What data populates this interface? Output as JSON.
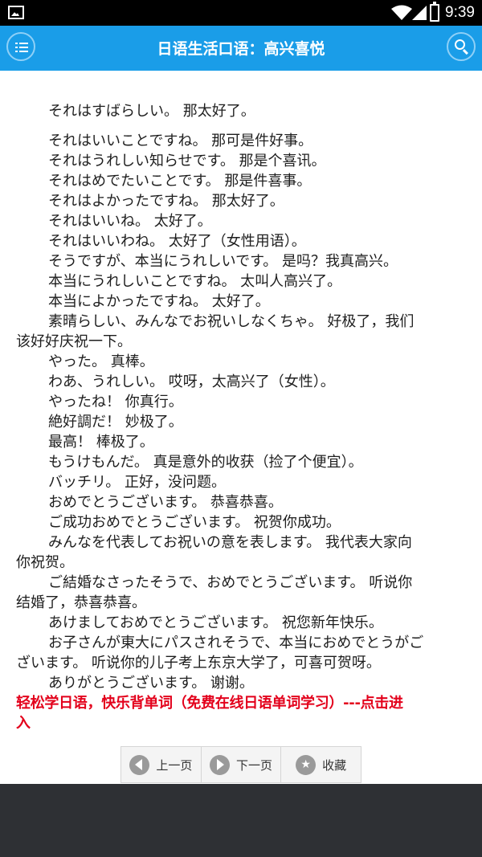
{
  "status_bar": {
    "time": "9:39"
  },
  "app_bar": {
    "title": "日语生活口语：高兴喜悦"
  },
  "lines": [
    "それはすばらしい。 那太好了。",
    "",
    "それはいいことですね。 那可是件好事。",
    "それはうれしい知らせです。 那是个喜讯。",
    "それはめでたいことです。 那是件喜事。",
    "それはよかったですね。 那太好了。",
    "それはいいね。 太好了。",
    "それはいいわね。 太好了（女性用语）。",
    "そうですが、本当にうれしいです。 是吗？我真高兴。",
    "本当にうれしいことですね。 太叫人高兴了。",
    "本当によかったですね。 太好了。",
    "素晴らしい、みんなでお祝いしなくちゃ。 好极了，我们",
    "该好好庆祝一下。",
    "やった。 真棒。",
    "わあ、うれしい。 哎呀，太高兴了（女性）。",
    "やったね！ 你真行。",
    "絶好調だ！ 妙极了。",
    "最高！ 棒极了。",
    "もうけもんだ。 真是意外的收获（捡了个便宜）。",
    "バッチリ。 正好，没问题。",
    "おめでとうございます。 恭喜恭喜。",
    "ご成功おめでとうございます。 祝贺你成功。",
    "みんなを代表してお祝いの意を表します。 我代表大家向",
    "你祝贺。",
    "ご結婚なさったそうで、おめでとうございます。 听说你",
    "结婚了，恭喜恭喜。",
    "あけましておめでとうございます。 祝您新年快乐。",
    "お子さんが東大にパスされそうで、本当におめでとうがご",
    "ざいます。 听说你的儿子考上东京大学了，可喜可贺呀。",
    "ありがとうございます。 谢谢。"
  ],
  "promo": {
    "line1": "轻松学日语，快乐背单词（免费在线日语单词学习）---点击进",
    "line2": "入"
  },
  "pager": {
    "prev": "上一页",
    "next": "下一页",
    "favorite": "收藏"
  },
  "colors": {
    "app_bar": "#1a9de8",
    "promo_text": "#e3001b",
    "bottom_area": "#2e3034"
  }
}
